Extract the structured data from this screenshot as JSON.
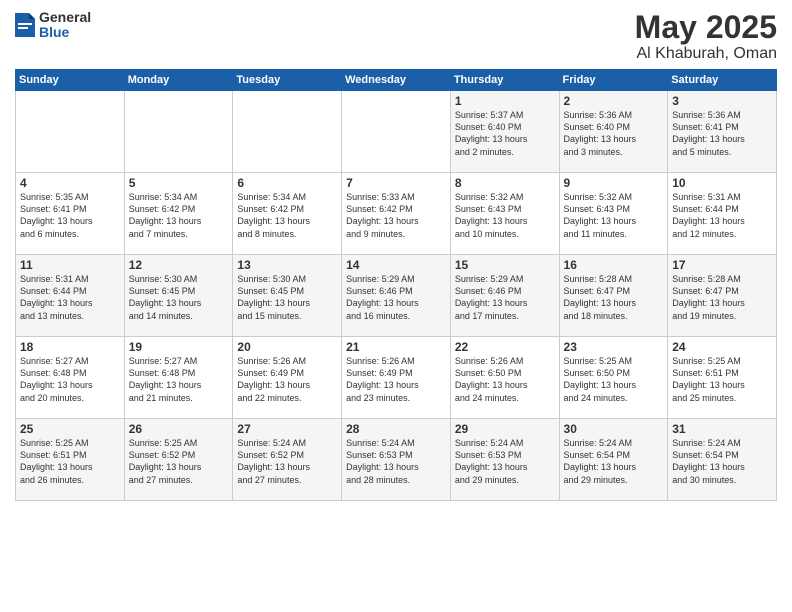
{
  "header": {
    "logo_general": "General",
    "logo_blue": "Blue",
    "month_title": "May 2025",
    "location": "Al Khaburah, Oman"
  },
  "days_of_week": [
    "Sunday",
    "Monday",
    "Tuesday",
    "Wednesday",
    "Thursday",
    "Friday",
    "Saturday"
  ],
  "weeks": [
    [
      {
        "day": "",
        "info": ""
      },
      {
        "day": "",
        "info": ""
      },
      {
        "day": "",
        "info": ""
      },
      {
        "day": "",
        "info": ""
      },
      {
        "day": "1",
        "info": "Sunrise: 5:37 AM\nSunset: 6:40 PM\nDaylight: 13 hours\nand 2 minutes."
      },
      {
        "day": "2",
        "info": "Sunrise: 5:36 AM\nSunset: 6:40 PM\nDaylight: 13 hours\nand 3 minutes."
      },
      {
        "day": "3",
        "info": "Sunrise: 5:36 AM\nSunset: 6:41 PM\nDaylight: 13 hours\nand 5 minutes."
      }
    ],
    [
      {
        "day": "4",
        "info": "Sunrise: 5:35 AM\nSunset: 6:41 PM\nDaylight: 13 hours\nand 6 minutes."
      },
      {
        "day": "5",
        "info": "Sunrise: 5:34 AM\nSunset: 6:42 PM\nDaylight: 13 hours\nand 7 minutes."
      },
      {
        "day": "6",
        "info": "Sunrise: 5:34 AM\nSunset: 6:42 PM\nDaylight: 13 hours\nand 8 minutes."
      },
      {
        "day": "7",
        "info": "Sunrise: 5:33 AM\nSunset: 6:42 PM\nDaylight: 13 hours\nand 9 minutes."
      },
      {
        "day": "8",
        "info": "Sunrise: 5:32 AM\nSunset: 6:43 PM\nDaylight: 13 hours\nand 10 minutes."
      },
      {
        "day": "9",
        "info": "Sunrise: 5:32 AM\nSunset: 6:43 PM\nDaylight: 13 hours\nand 11 minutes."
      },
      {
        "day": "10",
        "info": "Sunrise: 5:31 AM\nSunset: 6:44 PM\nDaylight: 13 hours\nand 12 minutes."
      }
    ],
    [
      {
        "day": "11",
        "info": "Sunrise: 5:31 AM\nSunset: 6:44 PM\nDaylight: 13 hours\nand 13 minutes."
      },
      {
        "day": "12",
        "info": "Sunrise: 5:30 AM\nSunset: 6:45 PM\nDaylight: 13 hours\nand 14 minutes."
      },
      {
        "day": "13",
        "info": "Sunrise: 5:30 AM\nSunset: 6:45 PM\nDaylight: 13 hours\nand 15 minutes."
      },
      {
        "day": "14",
        "info": "Sunrise: 5:29 AM\nSunset: 6:46 PM\nDaylight: 13 hours\nand 16 minutes."
      },
      {
        "day": "15",
        "info": "Sunrise: 5:29 AM\nSunset: 6:46 PM\nDaylight: 13 hours\nand 17 minutes."
      },
      {
        "day": "16",
        "info": "Sunrise: 5:28 AM\nSunset: 6:47 PM\nDaylight: 13 hours\nand 18 minutes."
      },
      {
        "day": "17",
        "info": "Sunrise: 5:28 AM\nSunset: 6:47 PM\nDaylight: 13 hours\nand 19 minutes."
      }
    ],
    [
      {
        "day": "18",
        "info": "Sunrise: 5:27 AM\nSunset: 6:48 PM\nDaylight: 13 hours\nand 20 minutes."
      },
      {
        "day": "19",
        "info": "Sunrise: 5:27 AM\nSunset: 6:48 PM\nDaylight: 13 hours\nand 21 minutes."
      },
      {
        "day": "20",
        "info": "Sunrise: 5:26 AM\nSunset: 6:49 PM\nDaylight: 13 hours\nand 22 minutes."
      },
      {
        "day": "21",
        "info": "Sunrise: 5:26 AM\nSunset: 6:49 PM\nDaylight: 13 hours\nand 23 minutes."
      },
      {
        "day": "22",
        "info": "Sunrise: 5:26 AM\nSunset: 6:50 PM\nDaylight: 13 hours\nand 24 minutes."
      },
      {
        "day": "23",
        "info": "Sunrise: 5:25 AM\nSunset: 6:50 PM\nDaylight: 13 hours\nand 24 minutes."
      },
      {
        "day": "24",
        "info": "Sunrise: 5:25 AM\nSunset: 6:51 PM\nDaylight: 13 hours\nand 25 minutes."
      }
    ],
    [
      {
        "day": "25",
        "info": "Sunrise: 5:25 AM\nSunset: 6:51 PM\nDaylight: 13 hours\nand 26 minutes."
      },
      {
        "day": "26",
        "info": "Sunrise: 5:25 AM\nSunset: 6:52 PM\nDaylight: 13 hours\nand 27 minutes."
      },
      {
        "day": "27",
        "info": "Sunrise: 5:24 AM\nSunset: 6:52 PM\nDaylight: 13 hours\nand 27 minutes."
      },
      {
        "day": "28",
        "info": "Sunrise: 5:24 AM\nSunset: 6:53 PM\nDaylight: 13 hours\nand 28 minutes."
      },
      {
        "day": "29",
        "info": "Sunrise: 5:24 AM\nSunset: 6:53 PM\nDaylight: 13 hours\nand 29 minutes."
      },
      {
        "day": "30",
        "info": "Sunrise: 5:24 AM\nSunset: 6:54 PM\nDaylight: 13 hours\nand 29 minutes."
      },
      {
        "day": "31",
        "info": "Sunrise: 5:24 AM\nSunset: 6:54 PM\nDaylight: 13 hours\nand 30 minutes."
      }
    ]
  ]
}
